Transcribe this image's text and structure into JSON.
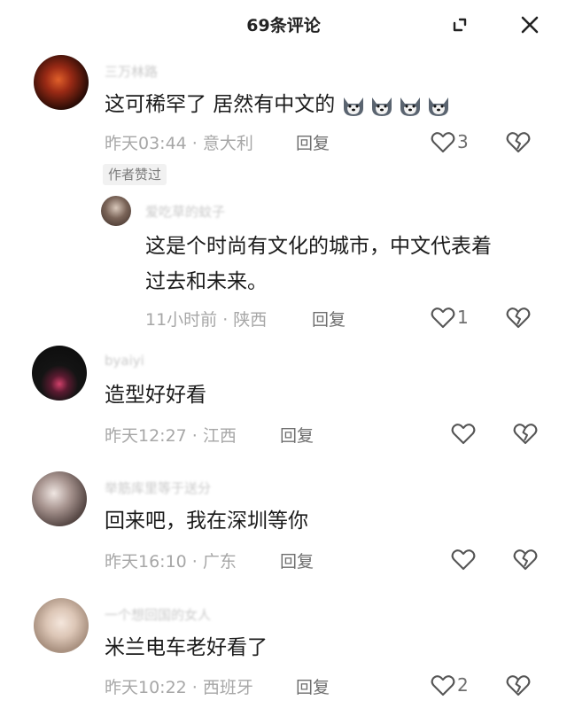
{
  "header": {
    "title": "69条评论"
  },
  "comments": [
    {
      "username": "三万林路",
      "text": "这可稀罕了 居然有中文的",
      "emoji": [
        "husky-emoji",
        "husky-emoji",
        "husky-emoji",
        "husky-emoji"
      ],
      "time_loc": "昨天03:44 · 意大利",
      "reply": "回复",
      "likes": "3",
      "badge": "作者赞过",
      "avatar_color": "#3a1a12"
    },
    {
      "username": "爱吃草的蚊子",
      "text_line1": "这是个时尚有文化的城市，中文代表着",
      "text_line2": "过去和未来。",
      "time_loc": "11小时前 · 陕西",
      "reply": "回复",
      "likes": "1",
      "avatar_color": "#6b5b52"
    },
    {
      "username": "byaiyi",
      "text": "造型好好看",
      "time_loc": "昨天12:27 · 江西",
      "reply": "回复",
      "avatar_color": "#161616"
    },
    {
      "username": "举筋库里等于送分",
      "text": "回来吧，我在深圳等你",
      "time_loc": "昨天16:10 · 广东",
      "reply": "回复",
      "avatar_color": "#9b8a86"
    },
    {
      "username": "一个想回国的女人",
      "text": "米兰电车老好看了",
      "time_loc": "昨天10:22 · 西班牙",
      "reply": "回复",
      "likes": "2",
      "avatar_color": "#d8c8bd"
    }
  ]
}
